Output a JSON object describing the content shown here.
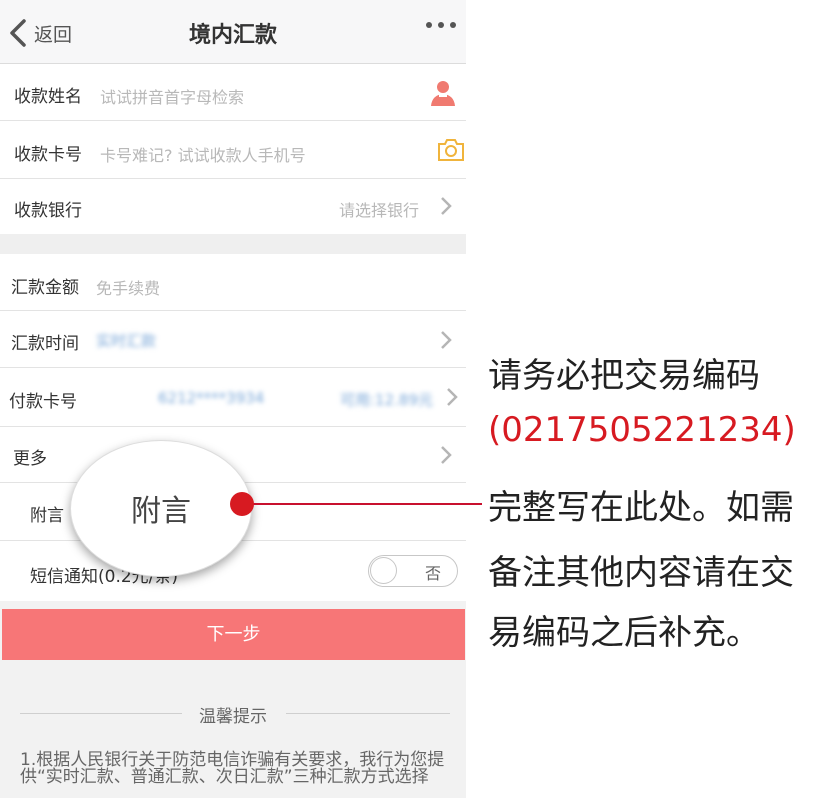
{
  "nav": {
    "back_label": "返回",
    "title": "境内汇款"
  },
  "payee": {
    "name_label": "收款姓名",
    "name_placeholder": "试试拼音首字母检索",
    "card_label": "收款卡号",
    "card_placeholder": "卡号难记? 试试收款人手机号",
    "bank_label": "收款银行",
    "bank_placeholder": "请选择银行"
  },
  "transfer": {
    "amount_label": "汇款金额",
    "amount_placeholder": "免手续费",
    "time_label": "汇款时间",
    "time_value": "实时汇款",
    "pay_card_label": "付款卡号",
    "pay_card_value": "6212****3934",
    "available": "可用:12.89元",
    "more_label": "更多",
    "memo_label": "附言",
    "sms_label": "短信通知(0.2元/条)",
    "sms_toggle": "否"
  },
  "next_button": "下一步",
  "tips": {
    "title": "温馨提示",
    "text": "1.根据人民银行关于防范电信诈骗有关要求，我行为您提供“实时汇款、普通汇款、次日汇款”三种汇款方式选择"
  },
  "magnifier_text": "附言",
  "annotation": {
    "line1": "请务必把交易编码",
    "code": "(0217505221234)",
    "line3": "完整写在此处。如需",
    "line4": "备注其他内容请在交",
    "line5": "易编码之后补充。"
  },
  "colors": {
    "accent_red": "#d71a21",
    "button": "#f77677",
    "camera": "#f0b43c",
    "person": "#f07a70"
  }
}
